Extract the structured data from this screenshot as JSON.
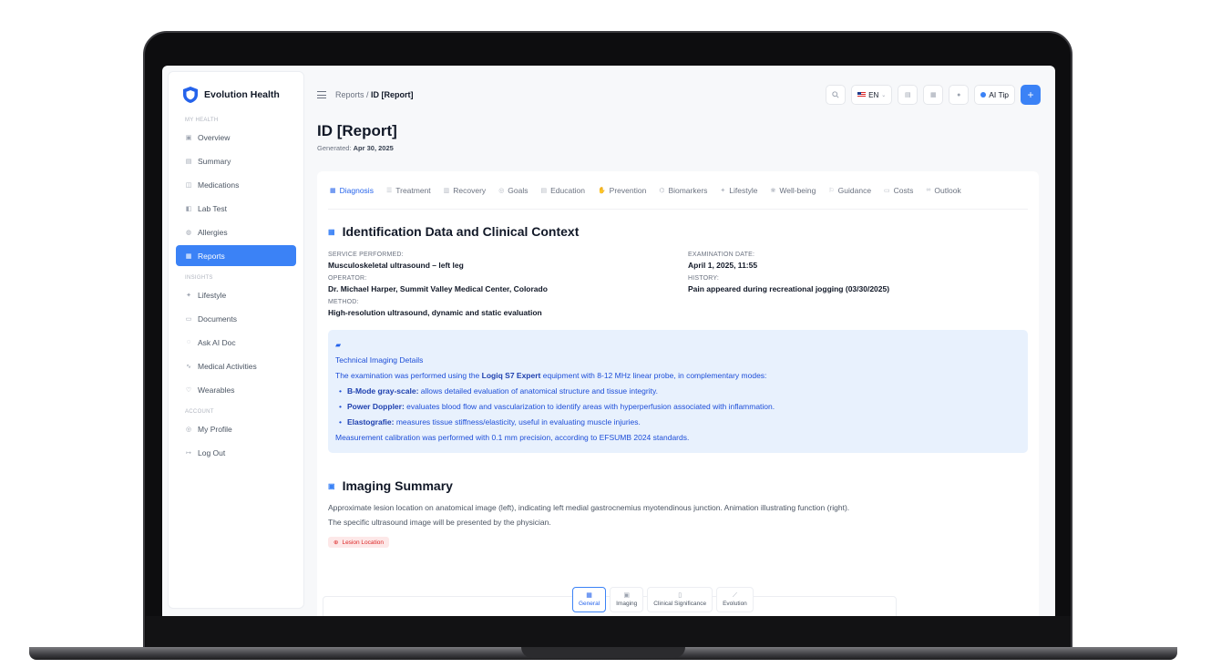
{
  "app": {
    "name": "Evolution Health"
  },
  "sidebar": {
    "sections": [
      {
        "label": "MY HEALTH",
        "items": [
          {
            "label": "Overview",
            "icon": "home-icon",
            "glyph": "▣"
          },
          {
            "label": "Summary",
            "icon": "chat-icon",
            "glyph": "▤"
          },
          {
            "label": "Medications",
            "icon": "pill-icon",
            "glyph": "◫"
          },
          {
            "label": "Lab Test",
            "icon": "flask-icon",
            "glyph": "◧"
          },
          {
            "label": "Allergies",
            "icon": "allergy-icon",
            "glyph": "◍"
          },
          {
            "label": "Reports",
            "icon": "document-icon",
            "glyph": "▦",
            "active": true
          }
        ]
      },
      {
        "label": "INSIGHTS",
        "items": [
          {
            "label": "Lifestyle",
            "icon": "runner-icon",
            "glyph": "✦"
          },
          {
            "label": "Documents",
            "icon": "folder-icon",
            "glyph": "▭"
          },
          {
            "label": "Ask AI Doc",
            "icon": "chat-bubble-icon",
            "glyph": "◌"
          },
          {
            "label": "Medical Activities",
            "icon": "pulse-icon",
            "glyph": "∿"
          },
          {
            "label": "Wearables",
            "icon": "heart-icon",
            "glyph": "♡"
          }
        ]
      },
      {
        "label": "ACCOUNT",
        "items": [
          {
            "label": "My Profile",
            "icon": "user-icon",
            "glyph": "◎"
          },
          {
            "label": "Log Out",
            "icon": "logout-icon",
            "glyph": "↦"
          }
        ]
      }
    ]
  },
  "header": {
    "breadcrumb_parent": "Reports",
    "breadcrumb_sep": " / ",
    "breadcrumb_current": "ID [Report]",
    "lang": "EN",
    "ai_tip": "AI Tip",
    "plus": "+"
  },
  "page": {
    "title": "ID [Report]",
    "generated_label": "Generated:",
    "generated_date": "Apr 30, 2025"
  },
  "tabs": [
    {
      "label": "Diagnosis",
      "icon": "document-icon",
      "glyph": "▦",
      "active": true
    },
    {
      "label": "Treatment",
      "icon": "list-icon",
      "glyph": "☰"
    },
    {
      "label": "Recovery",
      "icon": "clipboard-icon",
      "glyph": "▥"
    },
    {
      "label": "Goals",
      "icon": "target-icon",
      "glyph": "◎"
    },
    {
      "label": "Education",
      "icon": "book-icon",
      "glyph": "▤"
    },
    {
      "label": "Prevention",
      "icon": "hand-icon",
      "glyph": "✋"
    },
    {
      "label": "Biomarkers",
      "icon": "dna-icon",
      "glyph": "⌬"
    },
    {
      "label": "Lifestyle",
      "icon": "runner-icon",
      "glyph": "✦"
    },
    {
      "label": "Well-being",
      "icon": "lotus-icon",
      "glyph": "❀"
    },
    {
      "label": "Guidance",
      "icon": "guide-icon",
      "glyph": "⚐"
    },
    {
      "label": "Costs",
      "icon": "money-icon",
      "glyph": "▭"
    },
    {
      "label": "Outlook",
      "icon": "infinity-icon",
      "glyph": "∞"
    }
  ],
  "identification": {
    "title": "Identification Data and Clinical Context",
    "fields": [
      {
        "label": "SERVICE PERFORMED:",
        "value": "Musculoskeletal ultrasound – left leg"
      },
      {
        "label": "EXAMINATION DATE:",
        "value": "April 1, 2025, 11:55"
      },
      {
        "label": "OPERATOR:",
        "value": "Dr. Michael Harper, Summit Valley Medical Center, Colorado"
      },
      {
        "label": "HISTORY:",
        "value": "Pain appeared during recreational jogging (03/30/2025)"
      },
      {
        "label": "METHOD:",
        "value": "High-resolution ultrasound, dynamic and static evaluation"
      }
    ]
  },
  "technical": {
    "title": "Technical Imaging Details",
    "intro_pre": "The examination was performed using the ",
    "intro_bold": "Logiq S7 Expert",
    "intro_post": " equipment with 8-12 MHz linear probe, in complementary modes:",
    "bullets": [
      {
        "term": "B-Mode gray-scale:",
        "text": " allows detailed evaluation of anatomical structure and tissue integrity."
      },
      {
        "term": "Power Doppler:",
        "text": " evaluates blood flow and vascularization to identify areas with hyperperfusion associated with inflammation."
      },
      {
        "term": "Elastografie:",
        "text": " measures tissue stiffness/elasticity, useful in evaluating muscle injuries."
      }
    ],
    "footer": "Measurement calibration was performed with 0.1 mm precision, according to EFSUMB 2024 standards."
  },
  "imaging": {
    "title": "Imaging Summary",
    "line1": "Approximate lesion location on anatomical image (left), indicating left medial gastrocnemius myotendinous junction. Animation illustrating function (right).",
    "line2": "The specific ultrasound image will be presented by the physician.",
    "pill": "Lesion Location",
    "segments": [
      {
        "label": "General",
        "active": true
      },
      {
        "label": "Imaging"
      },
      {
        "label": "Clinical Significance"
      },
      {
        "label": "Evolution"
      }
    ]
  },
  "colors": {
    "accent": "#3b82f6",
    "infobox": "#e8f1fd",
    "danger": "#dc2626"
  }
}
